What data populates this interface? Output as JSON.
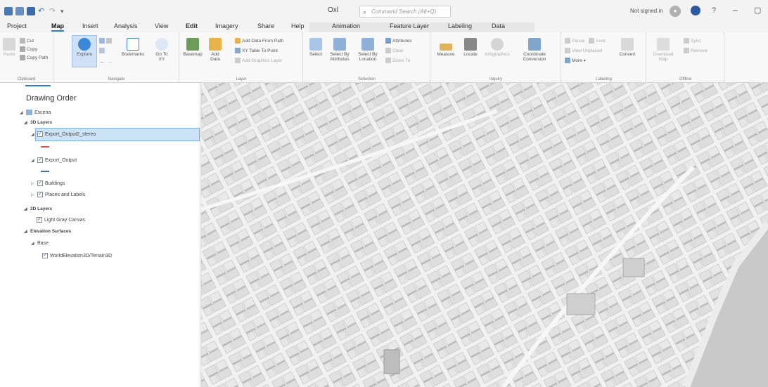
{
  "app": {
    "title": "Oxl",
    "search_placeholder": "Command Search (Alt+Q)",
    "signin": "Not signed in"
  },
  "tabs": [
    "Project",
    "Map",
    "Insert",
    "Analysis",
    "View",
    "Edit",
    "Imagery",
    "Share",
    "Help",
    "Animation",
    "Feature Layer",
    "Labeling",
    "Data"
  ],
  "active_tab": "Map",
  "ribbon": {
    "clipboard": {
      "label": "Clipboard",
      "paste": "Paste",
      "cut": "Cut",
      "copy": "Copy",
      "copy_path": "Copy Path"
    },
    "navigate": {
      "label": "Navigate",
      "explore": "Explore",
      "bookmarks": "Bookmarks",
      "goto": "Go To XY"
    },
    "layer": {
      "label": "Layer",
      "basemap": "Basemap",
      "add_data": "Add Data",
      "add_from_path": "Add Data From Path",
      "xy_table": "XY Table To Point",
      "add_graphics": "Add Graphics Layer"
    },
    "selection": {
      "label": "Selection",
      "select": "Select",
      "select_by_attr": "Select By Attributes",
      "select_by_loc": "Select By Location",
      "attributes": "Attributes",
      "clear": "Clear",
      "zoom_to": "Zoom To"
    },
    "inquiry": {
      "label": "Inquiry",
      "measure": "Measure",
      "locate": "Locate",
      "infographics": "Infographics",
      "coord_conv": "Coordinate Conversion"
    },
    "labeling": {
      "label": "Labeling",
      "pause": "Pause",
      "lock": "Lock",
      "view_unplaced": "View Unplaced",
      "more": "More",
      "convert": "Convert"
    },
    "offline": {
      "label": "Offline",
      "download_map": "Download Map",
      "sync": "Sync",
      "remove": "Remove"
    }
  },
  "contents": {
    "title": "Drawing Order",
    "scene": "Escena",
    "group_3d": "3D Layers",
    "layer_stereo": "Export_Output2_stereo",
    "layer_export": "Export_Output",
    "layer_buildings": "Buildings",
    "layer_places": "Places and Labels",
    "group_2d": "2D Layers",
    "layer_lightgray": "Light Gray Canvas",
    "group_elev": "Elevation Surfaces",
    "elev_base": "Base",
    "elev_world": "WorldElevation3D/Terrain3D"
  },
  "colors": {
    "accent": "#2d7bd4",
    "selection": "#cde3f7",
    "water": "#c8c8c8",
    "building": "#e4e4e4"
  }
}
